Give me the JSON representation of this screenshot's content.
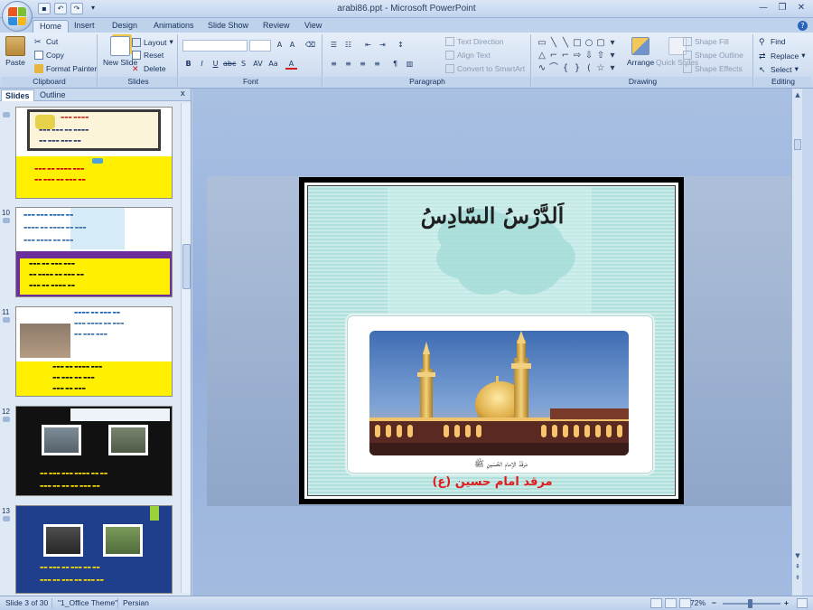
{
  "window": {
    "title": "arabi86.ppt - Microsoft PowerPoint"
  },
  "tabs": [
    {
      "label": "Home",
      "active": true
    },
    {
      "label": "Insert"
    },
    {
      "label": "Design"
    },
    {
      "label": "Animations"
    },
    {
      "label": "Slide Show"
    },
    {
      "label": "Review"
    },
    {
      "label": "View"
    }
  ],
  "ribbon": {
    "clipboard": {
      "label": "Clipboard",
      "paste": "Paste",
      "cut": "Cut",
      "copy": "Copy",
      "format_painter": "Format Painter"
    },
    "slides": {
      "label": "Slides",
      "new_slide": "New Slide",
      "new_slide_sub": "▾",
      "layout": "Layout",
      "reset": "Reset",
      "delete": "Delete"
    },
    "font": {
      "label": "Font"
    },
    "paragraph": {
      "label": "Paragraph",
      "text_direction": "Text Direction",
      "align_text": "Align Text",
      "convert_smartart": "Convert to SmartArt"
    },
    "drawing": {
      "label": "Drawing",
      "arrange": "Arrange",
      "quick_styles": "Quick Styles",
      "shape_fill": "Shape Fill",
      "shape_outline": "Shape Outline",
      "shape_effects": "Shape Effects"
    },
    "editing": {
      "label": "Editing",
      "find": "Find",
      "replace": "Replace",
      "select": "Select"
    }
  },
  "panel": {
    "tabs": [
      {
        "label": "Slides",
        "active": true
      },
      {
        "label": "Outline"
      }
    ],
    "close": "x",
    "thumbnails": [
      {
        "number": ""
      },
      {
        "number": "10"
      },
      {
        "number": "11"
      },
      {
        "number": "12"
      },
      {
        "number": "13"
      }
    ]
  },
  "slide": {
    "heading": "اَلدَّرْسُ السّادِسُ",
    "caption_arabic": "مَرقَدُ الإمامِ الحُسَينِ ﷺ",
    "caption_persian": "مرقد امام حسین (ع)"
  },
  "statusbar": {
    "slide_info": "Slide 3 of 30",
    "theme": "\"1_Office Theme\"",
    "language": "Persian",
    "zoom": "72%",
    "zoom_out": "−",
    "zoom_in": "+"
  },
  "icons": {
    "office_button": "office-logo-icon",
    "help": "help-icon"
  }
}
